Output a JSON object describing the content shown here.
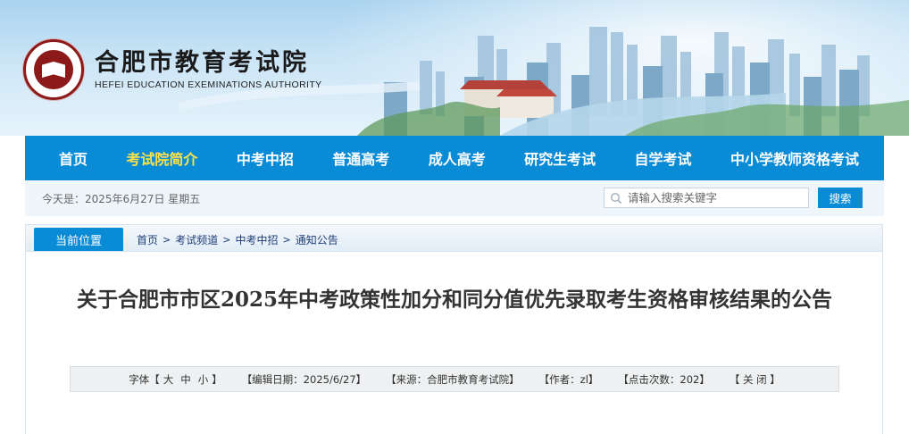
{
  "header": {
    "title_cn": "合肥市教育考试院",
    "title_en": "HEFEI EDUCATION EXEMINATIONS AUTHORITY"
  },
  "nav": {
    "items": [
      {
        "label": "首页",
        "active": false
      },
      {
        "label": "考试院简介",
        "active": true
      },
      {
        "label": "中考中招",
        "active": false
      },
      {
        "label": "普通高考",
        "active": false
      },
      {
        "label": "成人高考",
        "active": false
      },
      {
        "label": "研究生考试",
        "active": false
      },
      {
        "label": "自学考试",
        "active": false
      },
      {
        "label": "中小学教师资格考试",
        "active": false
      }
    ]
  },
  "topbar": {
    "today": "今天是：2025年6月27日 星期五",
    "search_placeholder": "请输入搜索关键字",
    "search_button": "搜索"
  },
  "location": {
    "tab": "当前位置",
    "crumbs": [
      "首页",
      "考试频道",
      "中考中招",
      "通知公告"
    ]
  },
  "article": {
    "title": "关于合肥市市区2025年中考政策性加分和同分值优先录取考生资格审核结果的公告",
    "meta": {
      "font_prefix": "字体【",
      "font_large": "大",
      "font_medium": "中",
      "font_small": "小",
      "font_suffix": "】",
      "edit_date": "【编辑日期：2025/6/27】",
      "source": "【来源：合肥市教育考试院】",
      "author": "【作者：zl】",
      "clicks": "【点击次数：202】",
      "close": "【 关 闭 】"
    }
  },
  "colors": {
    "nav_bg": "#0a8bd6",
    "nav_active": "#ffe24a",
    "seal": "#8d1a1a"
  }
}
